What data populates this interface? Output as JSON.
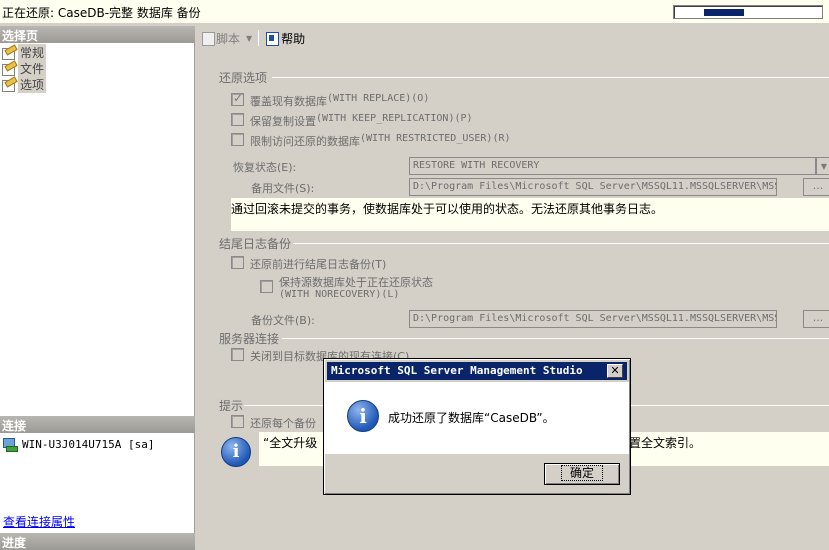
{
  "status_bar": {
    "title": "正在还原: CaseDB-完整 数据库 备份",
    "progress_fraction": 0.27
  },
  "left_pane": {
    "select_page_header": "选择页",
    "pages": [
      {
        "label": "常规"
      },
      {
        "label": "文件"
      },
      {
        "label": "选项"
      }
    ],
    "connection_header": "连接",
    "connection_server": "WIN-U3J014U715A [sa]",
    "view_connection_link": "查看连接属性",
    "progress_header": "进度"
  },
  "toolbar": {
    "script_label": "脚本",
    "help_label": "帮助"
  },
  "restore_options": {
    "header": "还原选项",
    "overwrite": {
      "label": "覆盖现有数据库",
      "code": "(WITH REPLACE)(O)",
      "checked": true
    },
    "keep_replication": {
      "label": "保留复制设置",
      "code": "(WITH KEEP_REPLICATION)(P)",
      "checked": false
    },
    "restricted_user": {
      "label": "限制访问还原的数据库",
      "code": "(WITH RESTRICTED_USER)(R)",
      "checked": false
    },
    "recovery_state_label": "恢复状态(E):",
    "recovery_state_value": "RESTORE WITH RECOVERY",
    "standby_file_label": "备用文件(S):",
    "standby_file_value": "D:\\Program Files\\Microsoft SQL Server\\MSSQL11.MSSQLSERVER\\MSS",
    "recovery_note": "通过回滚未提交的事务，使数据库处于可以使用的状态。无法还原其他事务日志。"
  },
  "tail_log": {
    "header": "结尾日志备份",
    "tail_backup": {
      "label": "还原前进行结尾日志备份(T)",
      "checked": false
    },
    "norecovery": {
      "label": "保持源数据库处于正在还原状态",
      "code": "(WITH NORECOVERY)(L)",
      "checked": false
    },
    "backup_file_label": "备份文件(B):",
    "backup_file_value": "D:\\Program Files\\Microsoft SQL Server\\MSSQL11.MSSQLSERVER\\MSS"
  },
  "server_connections": {
    "header": "服务器连接",
    "close_existing": {
      "label": "关闭到目标数据库的现有连接(C)",
      "checked": false
    }
  },
  "hints": {
    "header": "提示",
    "prompt_each": {
      "label": "还原每个备份",
      "checked": false
    },
    "fulltext_left": "“全文升级",
    "fulltext_right": "置全文索引。"
  },
  "dialog": {
    "title": "Microsoft SQL Server Management Studio",
    "close_glyph": "✕",
    "info_glyph": "i",
    "message": "成功还原了数据库“CaseDB”。",
    "ok_label": "确定"
  },
  "icons": [
    "page-icon",
    "server-icon",
    "script-icon",
    "help-icon",
    "info-icon",
    "close-icon",
    "chevron-down-icon"
  ]
}
